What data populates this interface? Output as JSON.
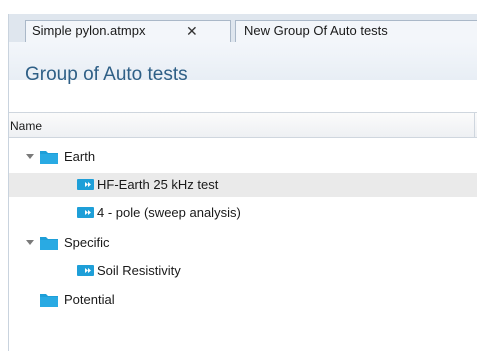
{
  "tabs": [
    {
      "label": "Simple pylon.atmpx",
      "close": "✕",
      "active": true
    },
    {
      "label": "New Group Of Auto tests",
      "active": false
    }
  ],
  "page": {
    "title": "Group of Auto tests"
  },
  "table": {
    "column_header": "Name"
  },
  "tree": [
    {
      "label": "Earth",
      "type": "folder",
      "expanded": true,
      "level": 0
    },
    {
      "label": "HF-Earth 25 kHz test",
      "type": "test",
      "level": 1,
      "selected": true
    },
    {
      "label": "4 - pole (sweep analysis)",
      "type": "test",
      "level": 1
    },
    {
      "label": "Specific",
      "type": "folder",
      "expanded": true,
      "level": 0
    },
    {
      "label": "Soil Resistivity",
      "type": "test",
      "level": 1
    },
    {
      "label": "Potential",
      "type": "folder",
      "expanded": false,
      "level": 0
    }
  ],
  "colors": {
    "title": "#2e5f86",
    "folder": "#1e9fd8",
    "test_icon": "#1e9fd8",
    "tab_bar": "#dfe6ee",
    "selected_row": "#eaeaea"
  },
  "icons": {
    "folder": "folder-icon",
    "test": "auto-test-icon",
    "expander": "expand-arrow-icon",
    "close": "close-icon"
  }
}
